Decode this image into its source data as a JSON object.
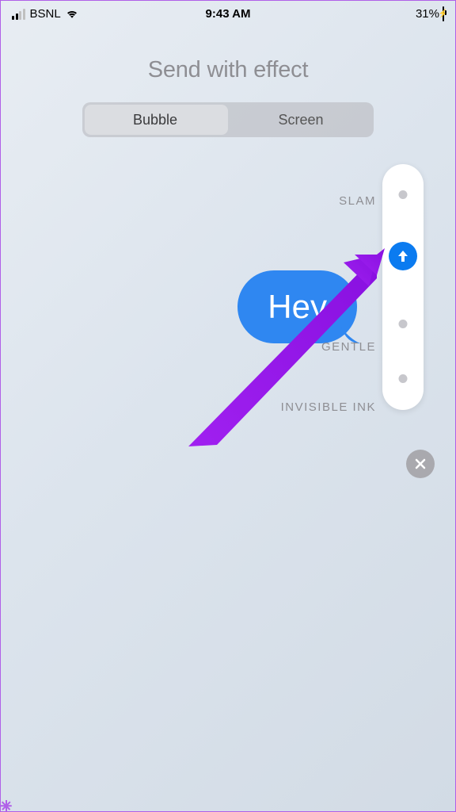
{
  "status": {
    "carrier": "BSNL",
    "time": "9:43 AM",
    "battery_pct": "31%"
  },
  "title": "Send with effect",
  "segmented": {
    "items": [
      "Bubble",
      "Screen"
    ],
    "active_index": 0
  },
  "effects": {
    "labels": [
      "SLAM",
      "",
      "GENTLE",
      "INVISIBLE INK"
    ],
    "selected_index": 1
  },
  "message": {
    "text": "Hey"
  },
  "colors": {
    "accent": "#2f87f1",
    "send_button": "#0b7bf0",
    "muted_text": "#8e8e93",
    "annotation": "#a020f0"
  }
}
